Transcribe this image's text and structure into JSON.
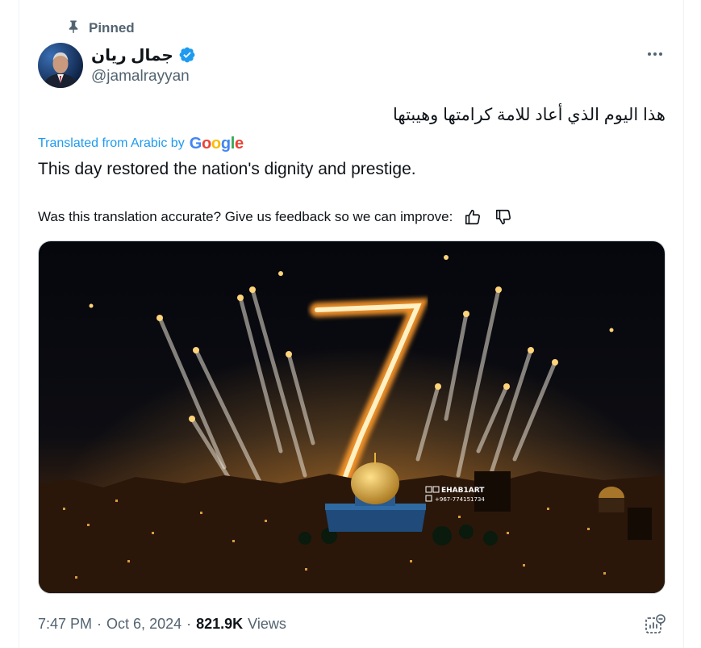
{
  "pinned_label": "Pinned",
  "author": {
    "display_name": "جمال ريان",
    "handle": "@jamalrayyan",
    "verified": true
  },
  "tweet": {
    "text_original": "هذا اليوم الذي أعاد للامة كرامتها وهيبتها",
    "translated_from": "Translated from Arabic by",
    "translator_brand": [
      "G",
      "o",
      "o",
      "g",
      "l",
      "e"
    ],
    "text_translated": "This day restored the nation's dignity and prestige.",
    "feedback_prompt": "Was this translation accurate? Give us feedback so we can improve:"
  },
  "media": {
    "big_numeral": "7",
    "watermark_name": "EHAB1ART",
    "watermark_phone": "+967-774151734"
  },
  "meta": {
    "time": "7:47 PM",
    "date": "Oct 6, 2024",
    "views_count": "821.9K",
    "views_label": "Views",
    "separator": "·"
  },
  "colors": {
    "accent": "#1d9bf0",
    "secondary_text": "#536471",
    "primary_text": "#0f1419"
  },
  "icons": {
    "pin": "pin-icon",
    "verified": "verified-badge-icon",
    "more": "more-dots-icon",
    "thumbs_up": "thumbs-up-icon",
    "thumbs_down": "thumbs-down-icon",
    "analytics": "analytics-icon"
  }
}
